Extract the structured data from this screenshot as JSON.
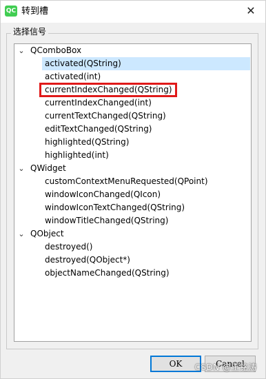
{
  "window": {
    "app_icon_text": "QC",
    "title": "转到槽",
    "close_glyph": "✕"
  },
  "group": {
    "label": "选择信号"
  },
  "tree": {
    "toggle_glyph": "⌄",
    "groups": [
      {
        "name": "QComboBox",
        "signals": [
          "activated(QString)",
          "activated(int)",
          "currentIndexChanged(QString)",
          "currentIndexChanged(int)",
          "currentTextChanged(QString)",
          "editTextChanged(QString)",
          "highlighted(QString)",
          "highlighted(int)"
        ]
      },
      {
        "name": "QWidget",
        "signals": [
          "customContextMenuRequested(QPoint)",
          "windowIconChanged(QIcon)",
          "windowIconTextChanged(QString)",
          "windowTitleChanged(QString)"
        ]
      },
      {
        "name": "QObject",
        "signals": [
          "destroyed()",
          "destroyed(QObject*)",
          "objectNameChanged(QString)"
        ]
      }
    ],
    "selected_signal": "activated(QString)",
    "annotated_signal": "currentIndexChanged(QString)"
  },
  "buttons": {
    "ok": "OK",
    "cancel": "Cancel"
  },
  "watermark": "CSDN @王铭涛",
  "colors": {
    "selection": "#cce8ff",
    "annotation": "#e01919",
    "default_button": "#0078d7"
  }
}
